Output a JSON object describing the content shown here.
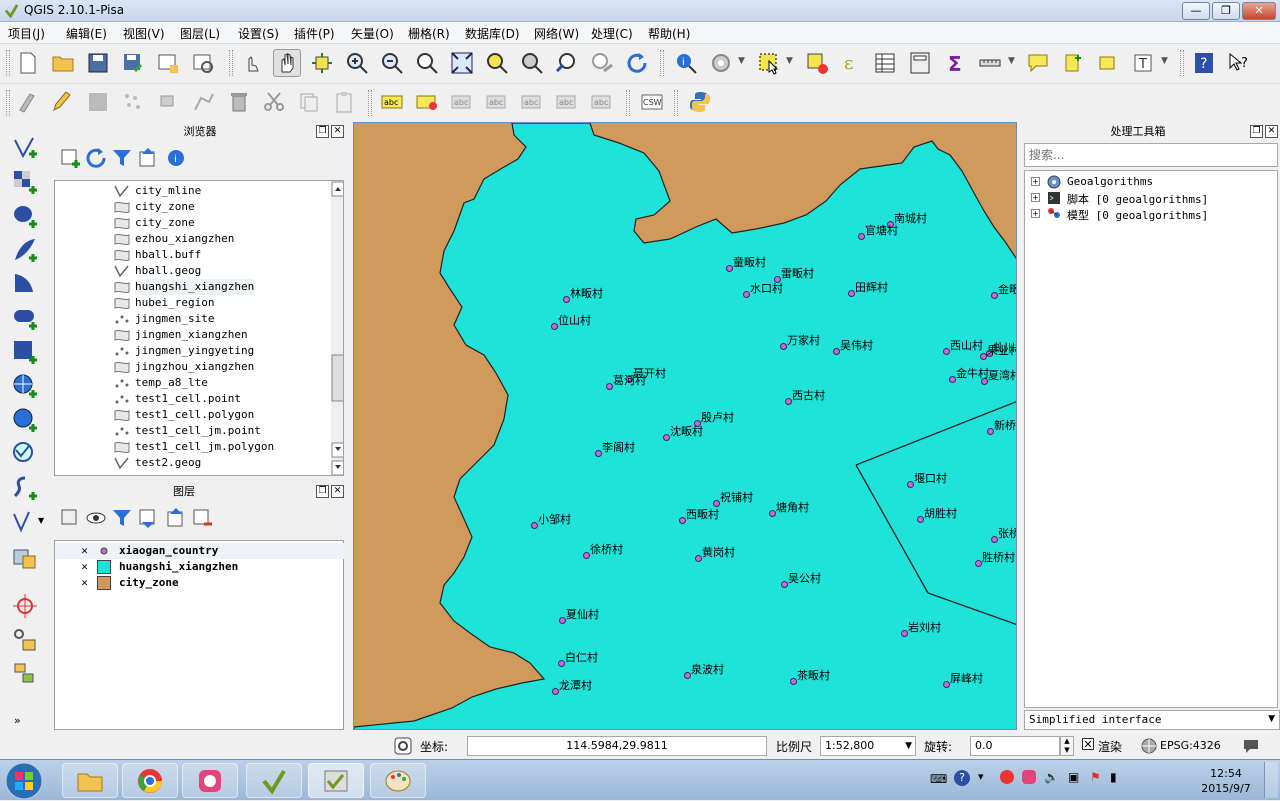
{
  "window": {
    "title": "QGIS 2.10.1-Pisa",
    "btn_min": "—",
    "btn_max": "❐",
    "btn_close": "✕"
  },
  "menu": [
    "项目(J)",
    "编辑(E)",
    "视图(V)",
    "图层(L)",
    "设置(S)",
    "插件(P)",
    "矢量(O)",
    "栅格(R)",
    "数据库(D)",
    "网络(W)",
    "处理(C)",
    "帮助(H)"
  ],
  "browser": {
    "title": "浏览器",
    "items": [
      "city_mline",
      "city_zone",
      "city_zone",
      "ezhou_xiangzhen",
      "hball.buff",
      "hball.geog",
      "huangshi_xiangzhen",
      "hubei_region",
      "jingmen_site",
      "jingmen_xiangzhen",
      "jingmen_yingyeting",
      "jingzhou_xiangzhen",
      "temp_a8_lte",
      "test1_cell.point",
      "test1_cell.polygon",
      "test1_cell_jm.point",
      "test1_cell_jm.polygon",
      "test2.geog"
    ],
    "selected_index": 6
  },
  "layers": {
    "title": "图层",
    "items": [
      {
        "name": "xiaogan_country",
        "symbol": "point",
        "color": "#b56de0"
      },
      {
        "name": "huangshi_xiangzhen",
        "symbol": "fill",
        "color": "#1fe3d9"
      },
      {
        "name": "city_zone",
        "symbol": "fill",
        "color": "#cf9a5c"
      }
    ]
  },
  "map": {
    "fill_color": "#1fe3d9",
    "bg_color": "#cf9a5c",
    "villages": [
      "南城村",
      "官塘村",
      "童畈村",
      "雷畈村",
      "水口村",
      "田辉村",
      "金畈",
      "林畈村",
      "位山村",
      "万家村",
      "吴伟村",
      "西山村",
      "虬川村",
      "果业村",
      "金牛村",
      "夏湾村",
      "聂开村",
      "葛河村",
      "西古村",
      "新桥",
      "殷卢村",
      "沈畈村",
      "李阁村",
      "堰口村",
      "胡胜村",
      "祝铺村",
      "塘角村",
      "西畈村",
      "小邹村",
      "张桥",
      "徐桥村",
      "黄岗村",
      "胜桥村",
      "吴公村",
      "夏仙村",
      "岩刘村",
      "白仁村",
      "泉波村",
      "茶畈村",
      "屏峰村",
      "龙潭村"
    ]
  },
  "processing": {
    "title": "处理工具箱",
    "search_placeholder": "搜索...",
    "tree": [
      "Geoalgorithms",
      "脚本 [0 geoalgorithms]",
      "模型 [0 geoalgorithms]"
    ],
    "mode": "Simplified interface"
  },
  "status": {
    "coord_label": "坐标:",
    "coord_value": "114.5984,29.9811",
    "scale_label": "比例尺",
    "scale_value": "1:52,800",
    "rotation_label": "旋转:",
    "rotation_value": "0.0",
    "render_label": "渲染",
    "crs": "EPSG:4326"
  },
  "clock": {
    "time": "12:54",
    "date": "2015/9/7"
  }
}
